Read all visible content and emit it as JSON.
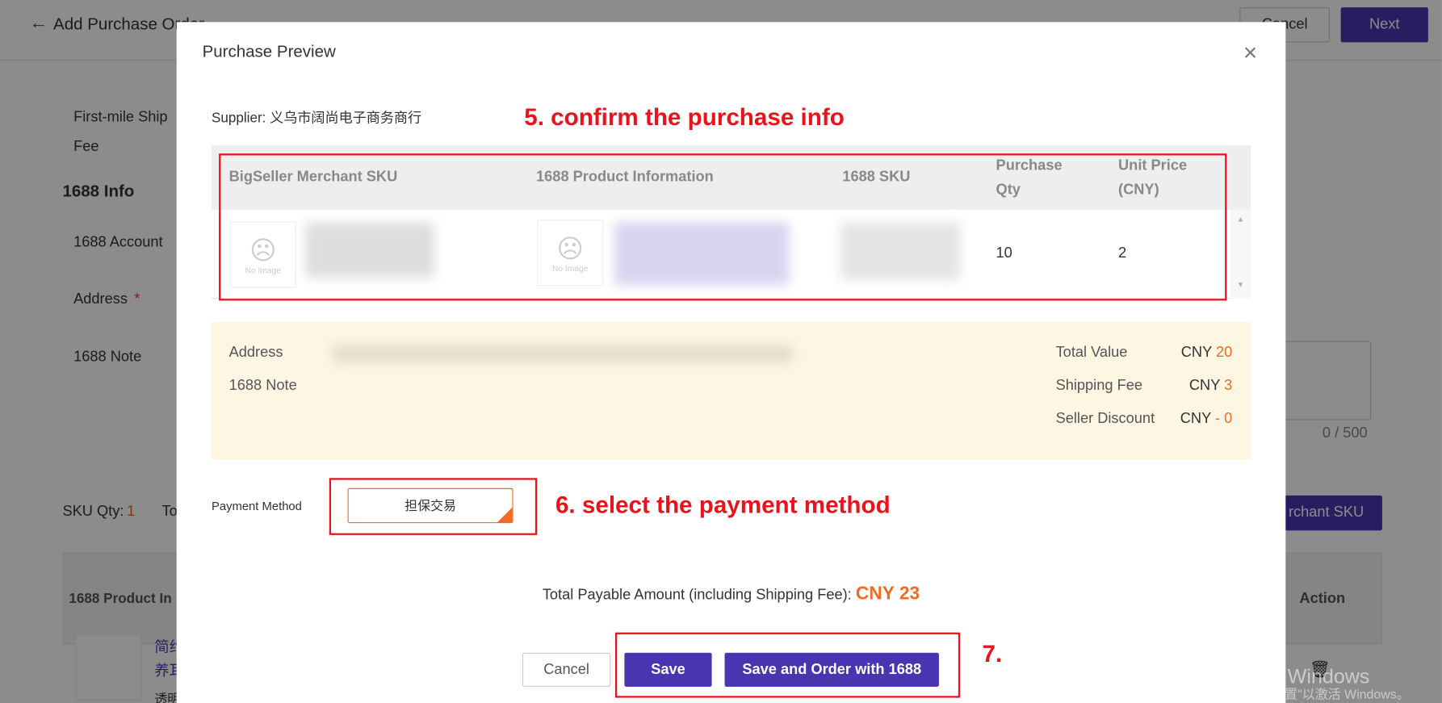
{
  "background": {
    "page_title": "Add Purchase Order",
    "cancel_label": "Cancel",
    "next_label": "Next",
    "first_mile_label": "First-mile Ship Fee",
    "info_heading": "1688 Info",
    "account_label": "1688 Account",
    "address_label": "Address",
    "note_label": "1688 Note",
    "note_count": "0 / 500",
    "sku_qty_label": "SKU Qty:",
    "sku_qty_value": "1",
    "total_label_partial": "To",
    "add_sku_partial": "rchant SKU",
    "table_col_product": "1688 Product In",
    "table_col_action": "Action",
    "row_title_partial_1": "简约",
    "row_title_partial_2": "养耳",
    "row_sub_partial": "透明"
  },
  "modal": {
    "title": "Purchase Preview",
    "supplier_label": "Supplier:",
    "supplier_name": "义乌市阔尚电子商务商行",
    "table": {
      "headers": [
        "BigSeller Merchant SKU",
        "1688 Product Information",
        "1688 SKU",
        "Purchase Qty",
        "Unit Price (CNY)"
      ],
      "rows": [
        {
          "no_image": "No Image",
          "qty": "10",
          "unit_price": "2"
        }
      ]
    },
    "summary": {
      "address_label": "Address",
      "note_label": "1688 Note",
      "total_value_label": "Total Value",
      "total_value_currency": "CNY",
      "total_value": "20",
      "shipping_fee_label": "Shipping Fee",
      "shipping_fee_currency": "CNY",
      "shipping_fee": "3",
      "discount_label": "Seller Discount",
      "discount_currency": "CNY",
      "discount": "- 0"
    },
    "payment_method_label": "Payment Method",
    "payment_method_value": "担保交易",
    "total_payable_label": "Total Payable Amount (including Shipping Fee):",
    "total_payable_value": "CNY 23",
    "cancel_label": "Cancel",
    "save_label": "Save",
    "save_order_label": "Save and Order with 1688"
  },
  "annotations": {
    "step5": "5. confirm the purchase info",
    "step6": "6. select the payment method",
    "step7": "7."
  },
  "watermark": {
    "line1": "激活 Windows",
    "line2": "转到\"设置\"以激活 Windows。"
  },
  "colors": {
    "accent": "#4a35b0",
    "annotation": "#e8141c",
    "amount": "#f26b24",
    "summary_bg": "#fdf6e3"
  }
}
